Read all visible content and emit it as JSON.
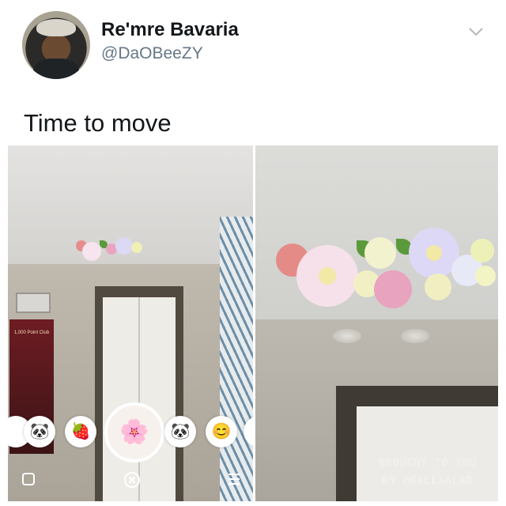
{
  "tweet": {
    "display_name": "Re'mre Bavaria",
    "handle": "@DaOBeeZY",
    "text": "Time to move",
    "menu_icon": "chevron-down-icon"
  },
  "left_photo": {
    "poster_text": "1,000 Point Club",
    "filters": [
      {
        "name": "panda-face-icon",
        "glyph": "🐼"
      },
      {
        "name": "strawberry-icon",
        "glyph": "🍓"
      },
      {
        "name": "flower-crown-face-icon",
        "glyph": "🌸"
      },
      {
        "name": "panda-icon",
        "glyph": "🐼"
      },
      {
        "name": "cute-face-icon",
        "glyph": "😊"
      }
    ],
    "camera_controls": {
      "left_icon": "square-icon",
      "center_icon": "close-circle-icon",
      "right_icon": "menu-lines-icon"
    }
  },
  "right_photo": {
    "watermark_line1": "BROUGHT TO YOU",
    "watermark_line2": "BY @KALESALAD"
  },
  "colors": {
    "name": "#14171a",
    "handle": "#657786",
    "door_frame": "#514a40"
  }
}
